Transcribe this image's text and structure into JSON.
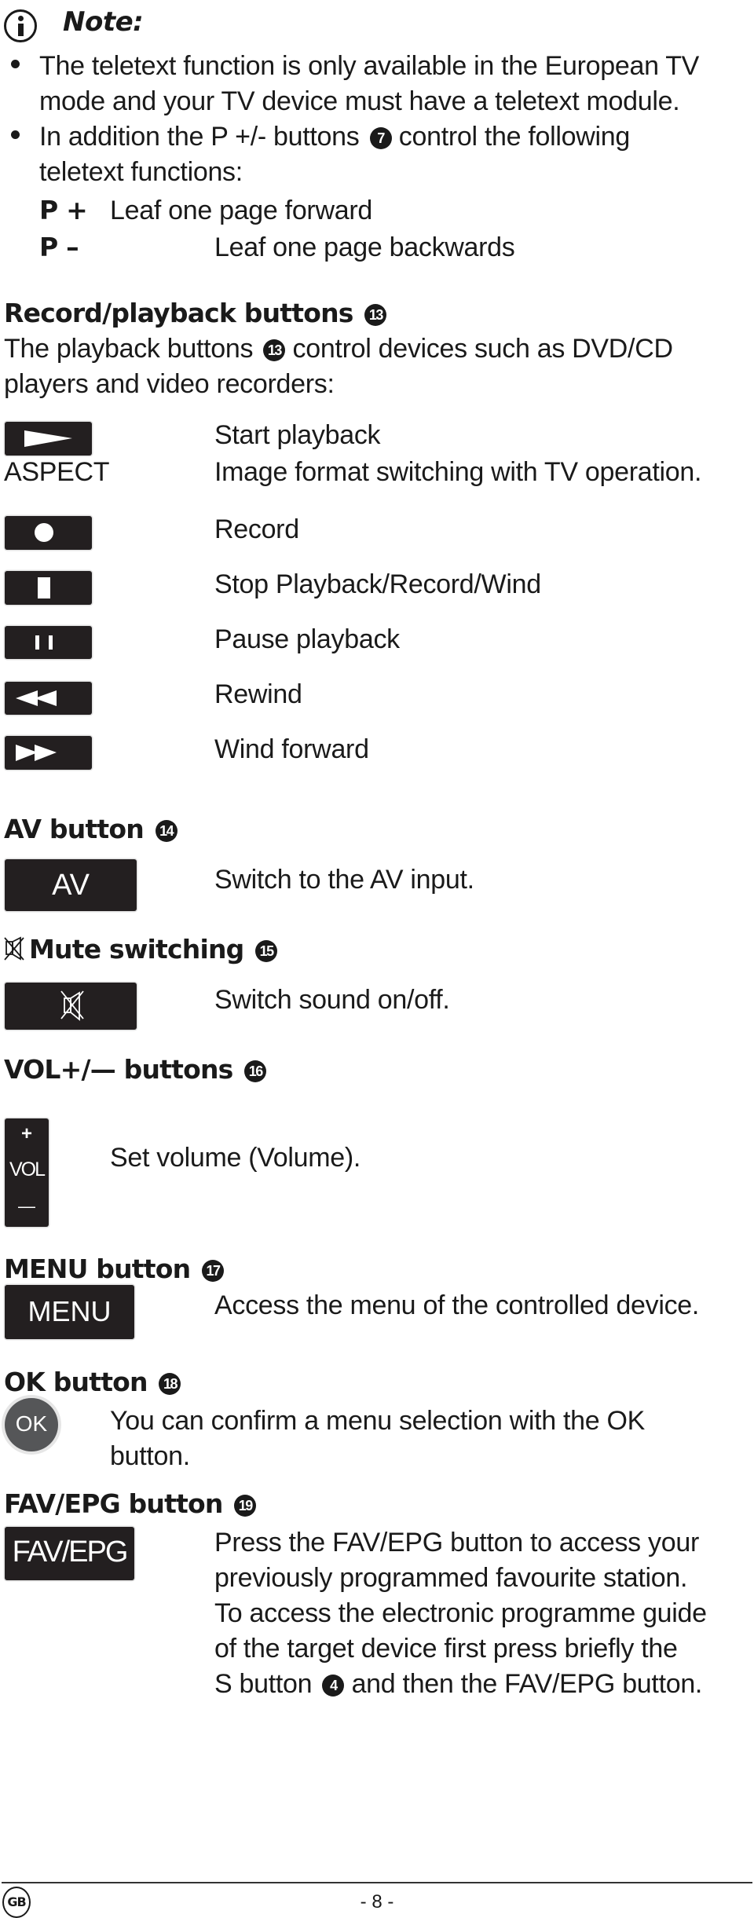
{
  "note": {
    "title": "Note:",
    "bullets": [
      {
        "lines": [
          "The teletext function is only available in the European TV",
          "mode and your TV device must have a teletext module."
        ]
      },
      {
        "line1_before": "In addition the P +/- buttons",
        "line1_ref": "7",
        "line1_after": "control the following",
        "line2": "teletext functions:"
      }
    ],
    "functions": [
      {
        "key": "P +",
        "desc": "Leaf one page forward"
      },
      {
        "key": "P –",
        "desc": "Leaf one page backwards"
      }
    ]
  },
  "record_section": {
    "heading": "Record/playback buttons",
    "ref": "13",
    "intro_before": "The playback buttons",
    "intro_ref": "13",
    "intro_after": "control devices such as DVD/CD",
    "intro_line2": "players and video recorders:",
    "rows": [
      {
        "icon": "play-icon",
        "desc": "Start playback"
      },
      {
        "label": "ASPECT",
        "desc": "Image format switching with TV operation."
      },
      {
        "icon": "record-icon",
        "desc": "Record"
      },
      {
        "icon": "stop-icon",
        "desc": "Stop Playback/Record/Wind"
      },
      {
        "icon": "pause-icon",
        "desc": "Pause playback"
      },
      {
        "icon": "rewind-icon",
        "desc": "Rewind"
      },
      {
        "icon": "fast-forward-icon",
        "desc": "Wind forward"
      }
    ]
  },
  "av_section": {
    "heading": "AV button",
    "ref": "14",
    "button_label": "AV",
    "desc": "Switch to the AV input."
  },
  "mute_section": {
    "heading": "Mute switching",
    "ref": "15",
    "icon": "mute-icon",
    "desc": "Switch sound on/off."
  },
  "vol_section": {
    "heading": "VOL+/— buttons",
    "ref": "16",
    "button_plus": "+",
    "button_label": "VOL",
    "button_minus": "—",
    "desc": "Set volume (Volume)."
  },
  "menu_section": {
    "heading": "MENU button",
    "ref": "17",
    "button_label": "MENU",
    "desc": "Access the menu of the controlled device."
  },
  "ok_section": {
    "heading": "OK button",
    "ref": "18",
    "button_label": "OK",
    "desc_lines": [
      "You can confirm a menu selection with the OK",
      "button."
    ]
  },
  "fav_section": {
    "heading": "FAV/EPG button",
    "ref": "19",
    "button_label": "FAV/EPG",
    "desc_lines": [
      "Press the FAV/EPG button to access your",
      "previously programmed favourite station.",
      "To access the electronic programme guide",
      "of the target device first press briefly the"
    ],
    "last_before": "S button",
    "last_ref": "4",
    "last_after": "and then the FAV/EPG button."
  },
  "footer": {
    "country": "GB",
    "page": "- 8 -"
  }
}
